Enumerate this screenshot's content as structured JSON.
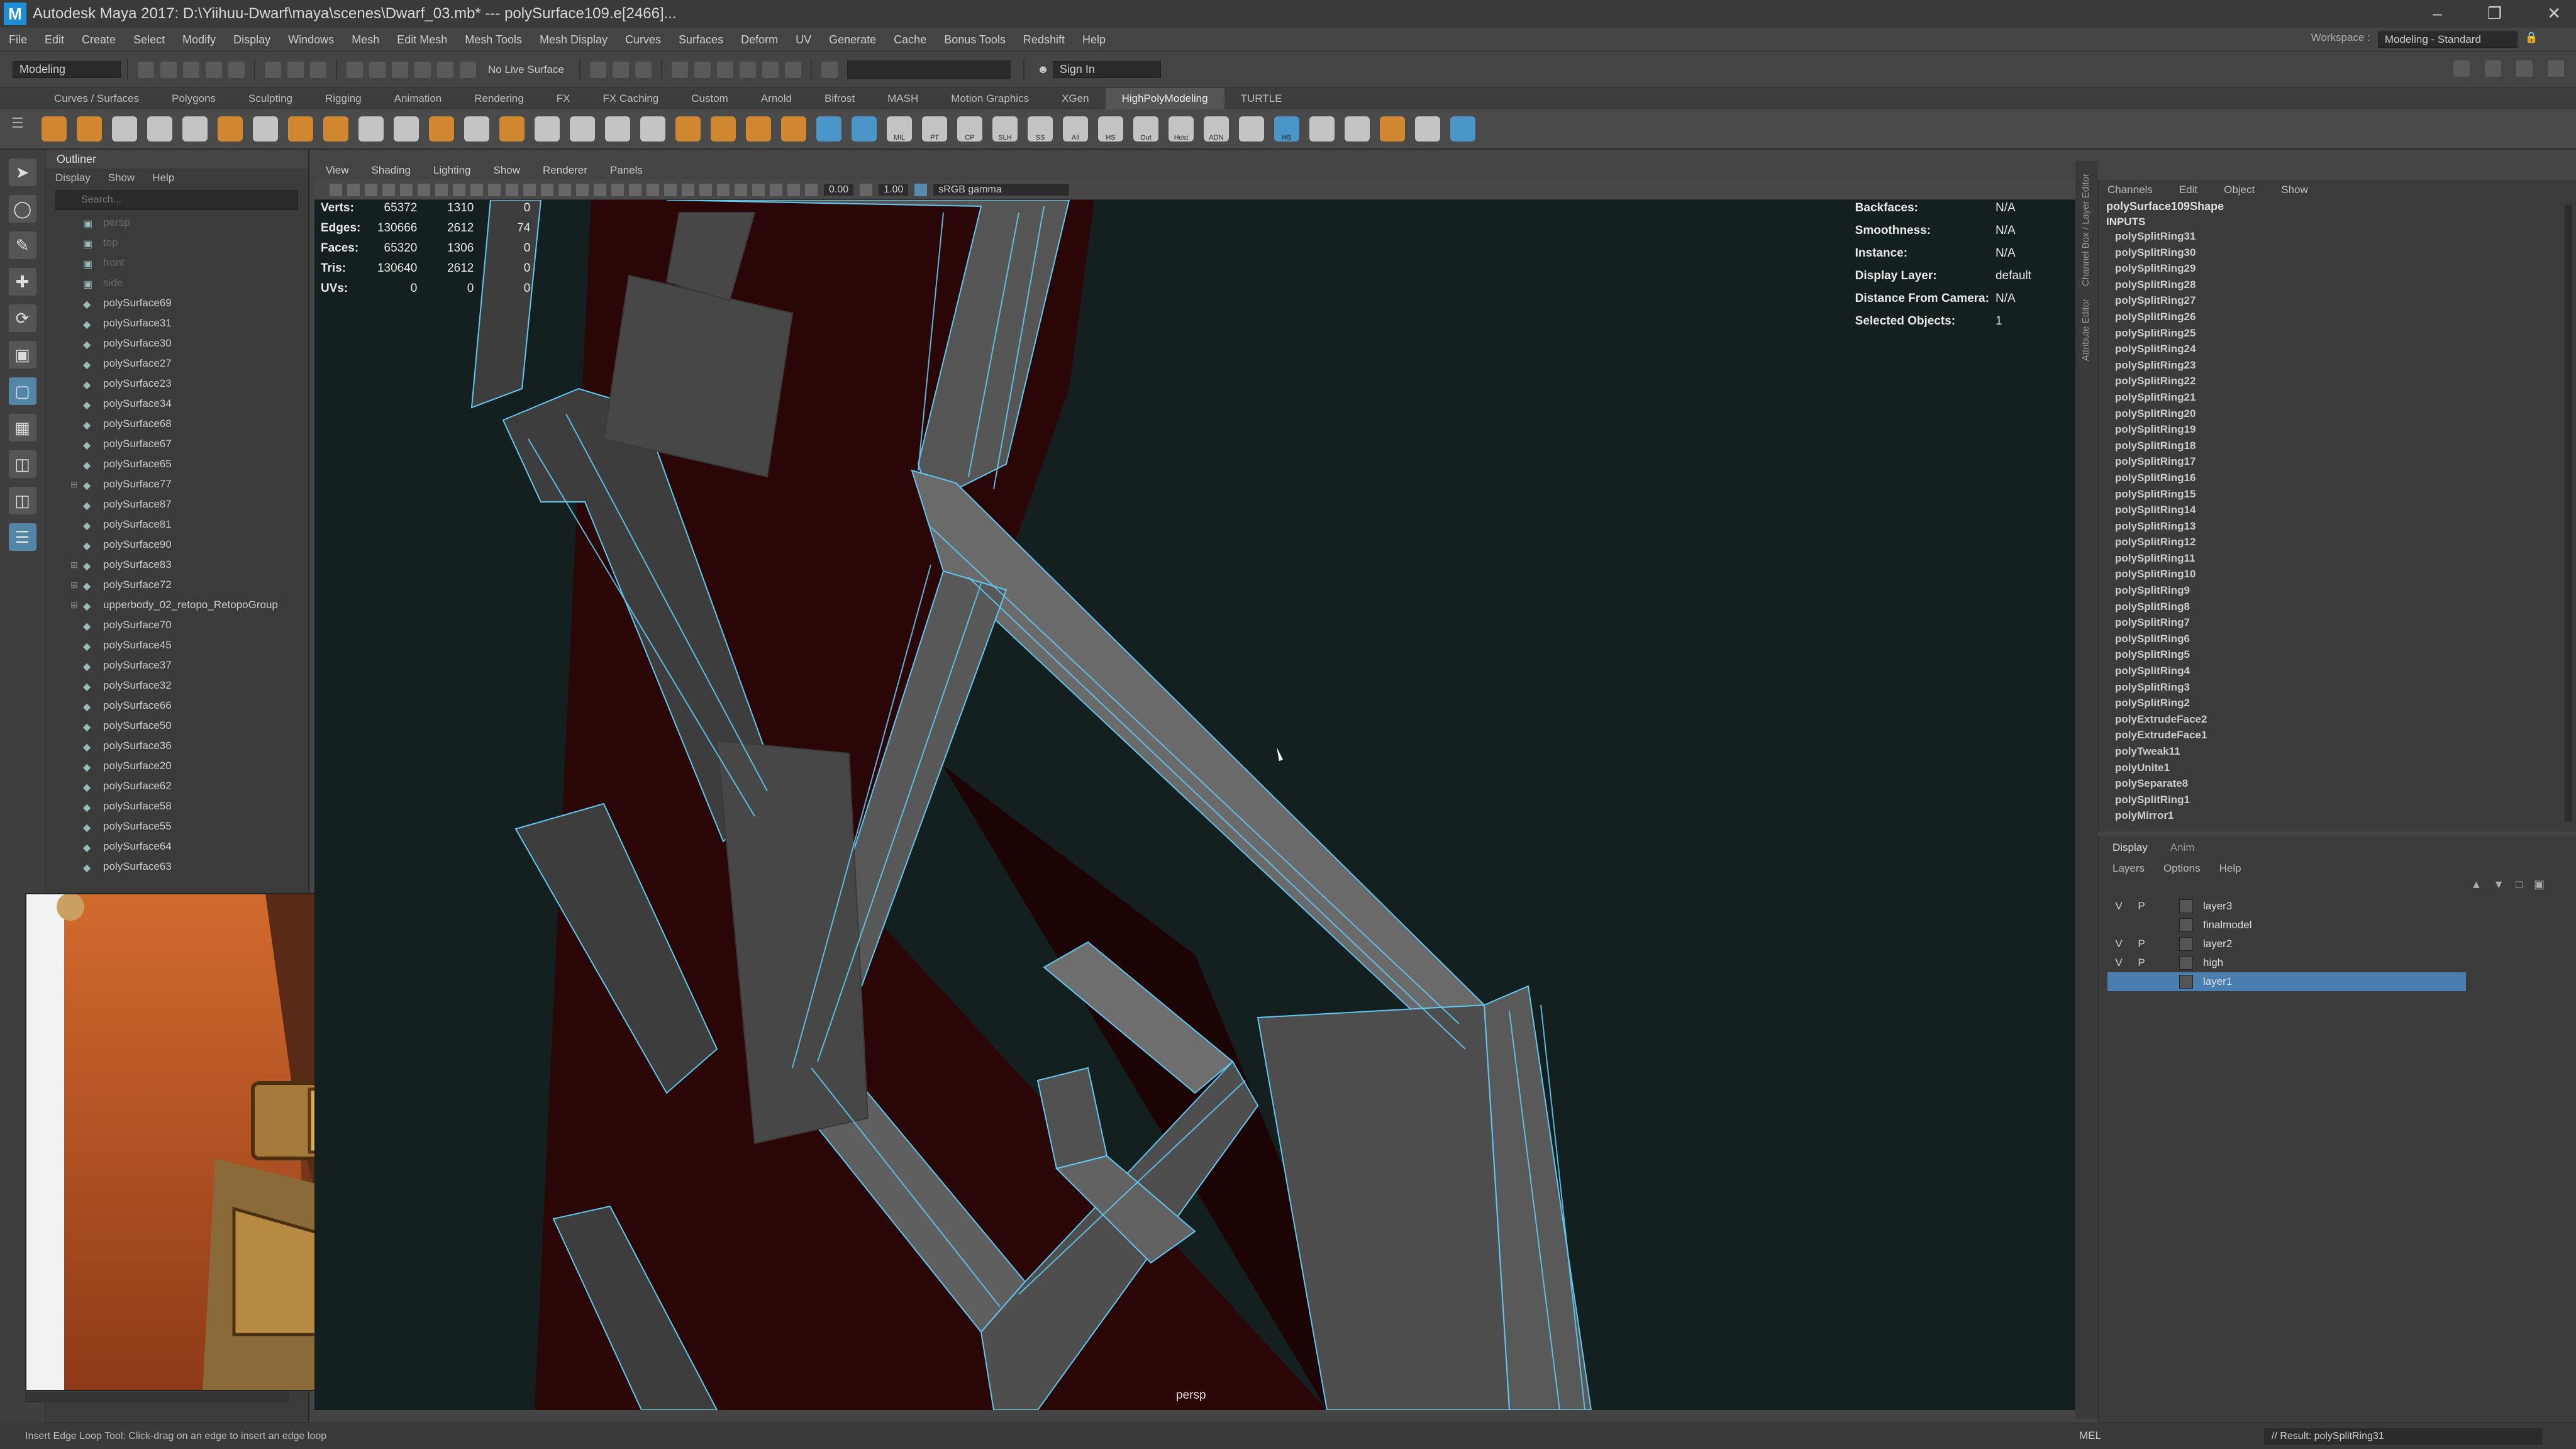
{
  "window": {
    "title": "Autodesk Maya 2017: D:\\Yiihuu-Dwarf\\maya\\scenes\\Dwarf_03.mb*   ---   polySurface109.e[2466]...",
    "logo": "M"
  },
  "menubar": {
    "items": [
      "File",
      "Edit",
      "Create",
      "Select",
      "Modify",
      "Display",
      "Windows",
      "Mesh",
      "Edit Mesh",
      "Mesh Tools",
      "Mesh Display",
      "Curves",
      "Surfaces",
      "Deform",
      "UV",
      "Generate",
      "Cache",
      "Bonus Tools",
      "Redshift",
      "Help"
    ],
    "workspace_label": "Workspace :",
    "workspace_value": "Modeling - Standard"
  },
  "statusline": {
    "mode": "Modeling",
    "live_surface": "No Live Surface",
    "sign_in": "Sign In"
  },
  "shelf": {
    "tabs": [
      "Curves / Surfaces",
      "Polygons",
      "Sculpting",
      "Rigging",
      "Animation",
      "Rendering",
      "FX",
      "FX Caching",
      "Custom",
      "Arnold",
      "Bifrost",
      "MASH",
      "Motion Graphics",
      "XGen",
      "HighPolyModeling",
      "TURTLE"
    ],
    "active_tab": "HighPolyModeling",
    "icon_colors": [
      "#e8922c",
      "#e8922c",
      "#d9d9d9",
      "#d9d9d9",
      "#d9d9d9",
      "#e8922c",
      "#d9d9d9",
      "#e8922c",
      "#e8922c",
      "#d9d9d9",
      "#d9d9d9",
      "#e8922c",
      "#d9d9d9",
      "#e8922c",
      "#d9d9d9",
      "#d9d9d9",
      "#d9d9d9",
      "#d9d9d9",
      "#e8922c",
      "#e8922c",
      "#e8922c",
      "#e8922c",
      "#4aa3df",
      "#4aa3df",
      "#d9d9d9",
      "#d9d9d9",
      "#d9d9d9",
      "#d9d9d9",
      "#d9d9d9",
      "#d9d9d9",
      "#d9d9d9",
      "#d9d9d9",
      "#d9d9d9",
      "#d9d9d9",
      "#d9d9d9",
      "#4aa3df",
      "#d9d9d9",
      "#d9d9d9",
      "#e8922c",
      "#d9d9d9",
      "#4aa3df"
    ],
    "icon_labels": [
      "",
      "",
      "",
      "",
      "",
      "",
      "",
      "",
      "",
      "",
      "",
      "",
      "",
      "",
      "",
      "",
      "",
      "",
      "",
      "",
      "",
      "",
      "",
      "",
      "MIL",
      "PT",
      "CP",
      "SLH",
      "SS",
      "All",
      "HS",
      "Out",
      "Hdst",
      "ADN",
      "",
      "HS",
      "",
      "",
      "",
      ""
    ]
  },
  "outliner": {
    "title": "Outliner",
    "menu": [
      "Display",
      "Show",
      "Help"
    ],
    "search_placeholder": "Search...",
    "items": [
      {
        "name": "persp",
        "dim": true,
        "expand": false
      },
      {
        "name": "top",
        "dim": true,
        "expand": false
      },
      {
        "name": "front",
        "dim": true,
        "expand": false
      },
      {
        "name": "side",
        "dim": true,
        "expand": false
      },
      {
        "name": "polySurface69",
        "dim": false,
        "expand": false
      },
      {
        "name": "polySurface31",
        "dim": false,
        "expand": false
      },
      {
        "name": "polySurface30",
        "dim": false,
        "expand": false
      },
      {
        "name": "polySurface27",
        "dim": false,
        "expand": false
      },
      {
        "name": "polySurface23",
        "dim": false,
        "expand": false
      },
      {
        "name": "polySurface34",
        "dim": false,
        "expand": false
      },
      {
        "name": "polySurface68",
        "dim": false,
        "expand": false
      },
      {
        "name": "polySurface67",
        "dim": false,
        "expand": false
      },
      {
        "name": "polySurface65",
        "dim": false,
        "expand": false
      },
      {
        "name": "polySurface77",
        "dim": false,
        "expand": true
      },
      {
        "name": "polySurface87",
        "dim": false,
        "expand": false
      },
      {
        "name": "polySurface81",
        "dim": false,
        "expand": false
      },
      {
        "name": "polySurface90",
        "dim": false,
        "expand": false
      },
      {
        "name": "polySurface83",
        "dim": false,
        "expand": true
      },
      {
        "name": "polySurface72",
        "dim": false,
        "expand": true
      },
      {
        "name": "upperbody_02_retopo_RetopoGroup",
        "dim": false,
        "expand": true
      },
      {
        "name": "polySurface70",
        "dim": false,
        "expand": false
      },
      {
        "name": "polySurface45",
        "dim": false,
        "expand": false
      },
      {
        "name": "polySurface37",
        "dim": false,
        "expand": false
      },
      {
        "name": "polySurface32",
        "dim": false,
        "expand": false
      },
      {
        "name": "polySurface66",
        "dim": false,
        "expand": false
      },
      {
        "name": "polySurface50",
        "dim": false,
        "expand": false
      },
      {
        "name": "polySurface36",
        "dim": false,
        "expand": false
      },
      {
        "name": "polySurface20",
        "dim": false,
        "expand": false
      },
      {
        "name": "polySurface62",
        "dim": false,
        "expand": false
      },
      {
        "name": "polySurface58",
        "dim": false,
        "expand": false
      },
      {
        "name": "polySurface55",
        "dim": false,
        "expand": false
      },
      {
        "name": "polySurface64",
        "dim": false,
        "expand": false
      },
      {
        "name": "polySurface63",
        "dim": false,
        "expand": false
      }
    ]
  },
  "viewport": {
    "menu": [
      "View",
      "Shading",
      "Lighting",
      "Show",
      "Renderer",
      "Panels"
    ],
    "exposure": "0.00",
    "gamma": "1.00",
    "color_space": "sRGB gamma",
    "camera": "persp",
    "hud_left": [
      {
        "label": "Verts:",
        "a": "65372",
        "b": "1310",
        "c": "0"
      },
      {
        "label": "Edges:",
        "a": "130666",
        "b": "2612",
        "c": "74"
      },
      {
        "label": "Faces:",
        "a": "65320",
        "b": "1306",
        "c": "0"
      },
      {
        "label": "Tris:",
        "a": "130640",
        "b": "2612",
        "c": "0"
      },
      {
        "label": "UVs:",
        "a": "0",
        "b": "0",
        "c": "0"
      }
    ],
    "hud_right": [
      {
        "label": "Backfaces:",
        "value": "N/A"
      },
      {
        "label": "Smoothness:",
        "value": "N/A"
      },
      {
        "label": "Instance:",
        "value": "N/A"
      },
      {
        "label": "Display Layer:",
        "value": "default"
      },
      {
        "label": "Distance From Camera:",
        "value": "N/A"
      },
      {
        "label": "Selected Objects:",
        "value": "1"
      }
    ],
    "wire_color": "#5fc8f0",
    "bg_color": "#13201f",
    "backdrop_color": "#2a0706"
  },
  "side_tabs": [
    "Channel Box / Layer Editor",
    "Attribute Editor"
  ],
  "channelbox": {
    "menu": [
      "Channels",
      "Edit",
      "Object",
      "Show"
    ],
    "shape": "polySurface109Shape",
    "inputs_label": "INPUTS",
    "inputs": [
      "polySplitRing31",
      "polySplitRing30",
      "polySplitRing29",
      "polySplitRing28",
      "polySplitRing27",
      "polySplitRing26",
      "polySplitRing25",
      "polySplitRing24",
      "polySplitRing23",
      "polySplitRing22",
      "polySplitRing21",
      "polySplitRing20",
      "polySplitRing19",
      "polySplitRing18",
      "polySplitRing17",
      "polySplitRing16",
      "polySplitRing15",
      "polySplitRing14",
      "polySplitRing13",
      "polySplitRing12",
      "polySplitRing11",
      "polySplitRing10",
      "polySplitRing9",
      "polySplitRing8",
      "polySplitRing7",
      "polySplitRing6",
      "polySplitRing5",
      "polySplitRing4",
      "polySplitRing3",
      "polySplitRing2",
      "polyExtrudeFace2",
      "polyExtrudeFace1",
      "polyTweak11",
      "polyUnite1",
      "polySeparate8",
      "polySplitRing1",
      "polyMirror1"
    ]
  },
  "layers": {
    "tabs": [
      "Display",
      "Anim"
    ],
    "active_tab": "Display",
    "menu": [
      "Layers",
      "Options",
      "Help"
    ],
    "rows": [
      {
        "v": "V",
        "p": "P",
        "name": "layer3",
        "selected": false
      },
      {
        "v": "",
        "p": "",
        "name": "finalmodel",
        "selected": false
      },
      {
        "v": "V",
        "p": "P",
        "name": "layer2",
        "selected": false
      },
      {
        "v": "V",
        "p": "P",
        "name": "high",
        "selected": false
      },
      {
        "v": "",
        "p": "",
        "name": "layer1",
        "selected": true
      }
    ]
  },
  "helpline": {
    "help": "Insert Edge Loop Tool: Click-drag on an edge to insert an edge loop",
    "mel": "MEL",
    "result": "// Result: polySplitRing31"
  }
}
